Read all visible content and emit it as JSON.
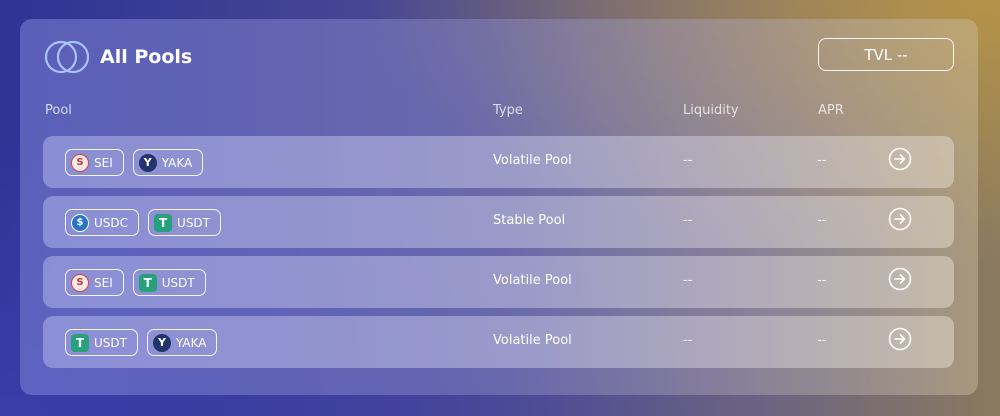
{
  "header": {
    "title": "All Pools",
    "tvl_label": "TVL --"
  },
  "columns": {
    "pool": "Pool",
    "type": "Type",
    "liquidity": "Liquidity",
    "apr": "APR"
  },
  "pools": [
    {
      "token_a": "SEI",
      "token_b": "YAKA",
      "icon_a": "sei-icon",
      "icon_b": "yaka-icon",
      "type": "Volatile Pool",
      "liquidity": "--",
      "apr": "--"
    },
    {
      "token_a": "USDC",
      "token_b": "USDT",
      "icon_a": "usdc-icon",
      "icon_b": "usdt-icon",
      "type": "Stable Pool",
      "liquidity": "--",
      "apr": "--"
    },
    {
      "token_a": "SEI",
      "token_b": "USDT",
      "icon_a": "sei-icon",
      "icon_b": "usdt-icon",
      "type": "Volatile Pool",
      "liquidity": "--",
      "apr": "--"
    },
    {
      "token_a": "USDT",
      "token_b": "YAKA",
      "icon_a": "usdt-icon",
      "icon_b": "yaka-icon",
      "type": "Volatile Pool",
      "liquidity": "--",
      "apr": "--"
    }
  ],
  "colors": {
    "sei": "#d2463f",
    "yaka": "#22346c",
    "usdc": "#2775ca",
    "usdt": "#26a17b"
  }
}
